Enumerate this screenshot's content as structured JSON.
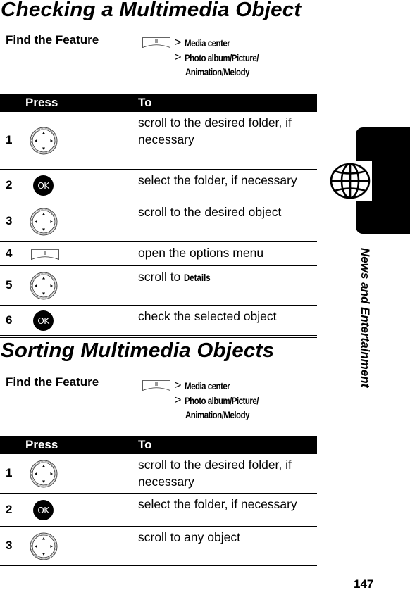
{
  "page": {
    "number": "147",
    "side_tab_label": "News and Entertainment",
    "side_tab_icon": "globe-icon"
  },
  "sections": [
    {
      "title": "Checking a Multimedia Object",
      "find_feature": {
        "label": "Find the Feature",
        "start_key_icon": "menu-key-icon",
        "separator": ">",
        "path": [
          "Media center",
          "Photo album/Picture/",
          "Animation/Melody"
        ]
      },
      "table": {
        "headers": [
          "Press",
          "To"
        ],
        "rows": [
          {
            "step": "1",
            "key_icon": "navigation-key-icon",
            "action": "scroll to the desired folder, if necessary"
          },
          {
            "step": "2",
            "key_icon": "ok-key-icon",
            "key_label": "OK",
            "action": "select the folder, if necessary"
          },
          {
            "step": "3",
            "key_icon": "navigation-key-icon",
            "action": "scroll to the desired object"
          },
          {
            "step": "4",
            "key_icon": "menu-key-icon",
            "action": "open the options menu"
          },
          {
            "step": "5",
            "key_icon": "navigation-key-icon",
            "action_prefix": "scroll to ",
            "action_bold": "Details"
          },
          {
            "step": "6",
            "key_icon": "ok-key-icon",
            "key_label": "OK",
            "action": "check the selected object"
          }
        ]
      }
    },
    {
      "title": "Sorting Multimedia Objects",
      "find_feature": {
        "label": "Find the Feature",
        "start_key_icon": "menu-key-icon",
        "separator": ">",
        "path": [
          "Media center",
          "Photo album/Picture/",
          "Animation/Melody"
        ]
      },
      "table": {
        "headers": [
          "Press",
          "To"
        ],
        "rows": [
          {
            "step": "1",
            "key_icon": "navigation-key-icon",
            "action": "scroll to the desired folder, if necessary"
          },
          {
            "step": "2",
            "key_icon": "ok-key-icon",
            "key_label": "OK",
            "action": "select the folder, if necessary"
          },
          {
            "step": "3",
            "key_icon": "navigation-key-icon",
            "action": "scroll to any object"
          }
        ]
      }
    }
  ]
}
